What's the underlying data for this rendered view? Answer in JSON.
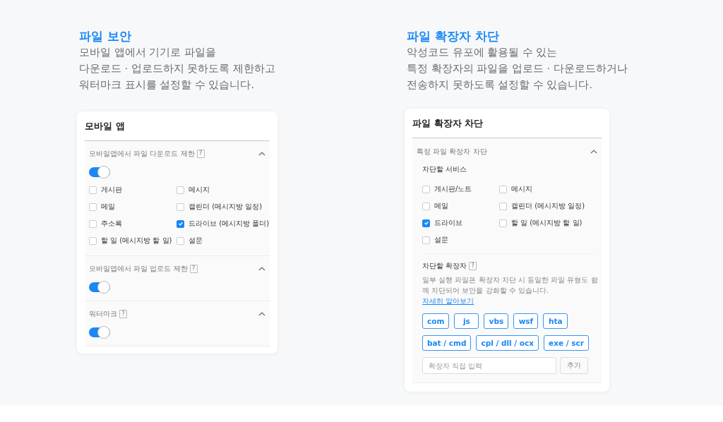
{
  "intros": [
    {
      "title": "파일 보안",
      "lines": [
        "모바일 앱에서 기기로 파일을",
        "다운로드 · 업로드하지 못하도록 제한하고",
        "워터마크 표시를 설정할 수 있습니다."
      ]
    },
    {
      "title": "파일 확장자 차단",
      "lines": [
        "악성코드 유포에 활용될 수 있는",
        "특정 확장자의 파일을 업로드 · 다운로드하거나",
        "전송하지 못하도록 설정할 수 있습니다."
      ]
    }
  ],
  "mobile_app_card": {
    "title": "모바일 앱",
    "sections": [
      {
        "label": "모바일앱에서 파일 다운로드 제한",
        "help": "?",
        "expanded": true,
        "on": true,
        "options": [
          {
            "label": "게시판",
            "checked": false
          },
          {
            "label": "메시지",
            "checked": false
          },
          {
            "label": "메일",
            "checked": false
          },
          {
            "label": "캘린더 (메시지방 일정)",
            "checked": false
          },
          {
            "label": "주소록",
            "checked": false
          },
          {
            "label": "드라이브 (메시지방 폴더)",
            "checked": true
          },
          {
            "label": "할 일 (메시지방 할 일)",
            "checked": false
          },
          {
            "label": "설문",
            "checked": false
          }
        ]
      },
      {
        "label": "모바일앱에서 파일 업로드 제한",
        "help": "?",
        "expanded": true,
        "on": true
      },
      {
        "label": "워터마크",
        "help": "?",
        "expanded": true,
        "on": true
      }
    ]
  },
  "extension_card": {
    "title": "파일 확장자 차단",
    "section": {
      "label": "특정 파일 확장자 차단",
      "expanded": true,
      "services_label": "차단할 서비스",
      "services": [
        {
          "label": "게시판/노트",
          "checked": false
        },
        {
          "label": "메시지",
          "checked": false
        },
        {
          "label": "메일",
          "checked": false
        },
        {
          "label": "캘린더 (메시지방 일정)",
          "checked": false
        },
        {
          "label": "드라이브",
          "checked": true
        },
        {
          "label": "할 일 (메시지방 할 일)",
          "checked": false
        },
        {
          "label": "설문",
          "checked": false
        }
      ],
      "extensions_label": "차단할 확장자",
      "help": "?",
      "description": "일부 실행 파일은 확장자 차단 시 동일한 파일 유형도 함께 차단되어 보안을 강화할 수 있습니다.",
      "link": "자세히 알아보기",
      "extension_rows": [
        [
          "com",
          "js",
          "vbs",
          "wsf",
          "hta"
        ],
        [
          "bat / cmd",
          "cpl / dll / ocx",
          "exe / scr"
        ]
      ],
      "input_placeholder": "확장자 직접 입력",
      "add_button": {
        "label": "추가",
        "disabled": true
      }
    }
  }
}
